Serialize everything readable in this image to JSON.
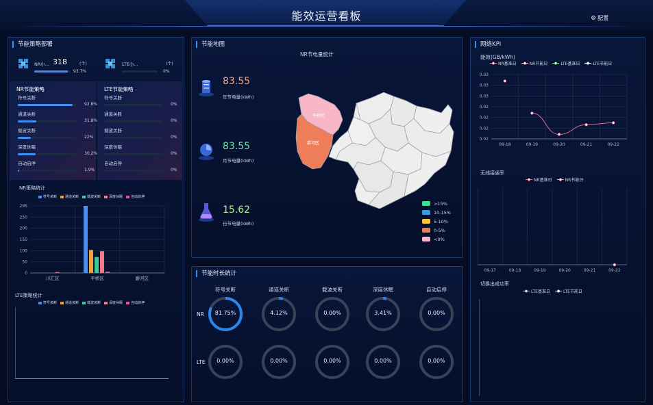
{
  "header": {
    "title": "能效运营看板",
    "config_label": "配置"
  },
  "left": {
    "title": "节能策略部署",
    "nr_summary": {
      "label": "NR小...",
      "count": "318",
      "unit": "(个)",
      "pct": "93.7%",
      "fill": 0.937
    },
    "lte_summary": {
      "label": "LTE小...",
      "unit": "(个)",
      "pct": "0%",
      "fill": 0
    },
    "nr_strategy": {
      "title": "NR节能策略",
      "items": [
        {
          "label": "符号关断",
          "pct": "92.8%",
          "fill": 0.928
        },
        {
          "label": "通道关断",
          "pct": "31.8%",
          "fill": 0.318
        },
        {
          "label": "载波关断",
          "pct": "22%",
          "fill": 0.22
        },
        {
          "label": "深度休眠",
          "pct": "30.2%",
          "fill": 0.302
        },
        {
          "label": "自动启停",
          "pct": "1.9%",
          "fill": 0.019
        }
      ]
    },
    "lte_strategy": {
      "title": "LTE节能策略",
      "items": [
        {
          "label": "符号关断",
          "pct": "0%"
        },
        {
          "label": "通道关断",
          "pct": "0%"
        },
        {
          "label": "载波关断",
          "pct": "0%"
        },
        {
          "label": "深度休眠",
          "pct": "0%"
        },
        {
          "label": "自动启停",
          "pct": "0%"
        }
      ]
    },
    "nr_chart_title": "NR策略统计",
    "lte_chart_title": "LTE策略统计"
  },
  "legend_strategy": [
    "符号关断",
    "通道关断",
    "载波关断",
    "深度休眠",
    "自动启停"
  ],
  "chart_data": [
    {
      "type": "bar",
      "title": "NR策略统计",
      "categories": [
        "川汇区",
        "平桥区",
        "爵河区"
      ],
      "ylim": [
        0,
        295
      ],
      "yticks": [
        "295",
        "250",
        "200",
        "150",
        "100",
        "50",
        "0"
      ],
      "series": [
        {
          "name": "符号关断",
          "color": "#4a8cf0",
          "values": [
            0,
            295,
            0
          ]
        },
        {
          "name": "通道关断",
          "color": "#f0a23a",
          "values": [
            0,
            101,
            0
          ]
        },
        {
          "name": "载波关断",
          "color": "#3cc99a",
          "values": [
            0,
            70,
            0
          ]
        },
        {
          "name": "深度休眠",
          "color": "#f07a8a",
          "values": [
            4,
            96,
            0
          ]
        },
        {
          "name": "自动启停",
          "color": "#e0508a",
          "values": [
            0,
            6,
            0
          ]
        }
      ]
    },
    {
      "type": "line",
      "title": "能效(GB/kWh)",
      "categories": [
        "09-18",
        "09-19",
        "09-20",
        "09-21",
        "09-22"
      ],
      "yticks": [
        "0.03",
        "0.03",
        "0.03",
        "0.02",
        "0.02",
        "0.02",
        "0.02"
      ],
      "legend": [
        "NR基准日",
        "NR节能日",
        "LTE基准日",
        "LTE节能日"
      ],
      "series": [
        {
          "name": "NR节能日",
          "color": "#e26a86",
          "values": [
            0.0285,
            0.0235,
            0.0202,
            0.0217,
            0.022
          ]
        }
      ]
    }
  ],
  "map": {
    "panel_title": "节能地图",
    "chart_title": "NR节电量统计",
    "stats": [
      {
        "value": "83.55",
        "label": "年节电量(kWh)",
        "color": "#f3a67a"
      },
      {
        "value": "83.55",
        "label": "月节电量(kWh)",
        "color": "#6fe0a8"
      },
      {
        "value": "15.62",
        "label": "日节电量(kWh)",
        "color": "#b3f08a"
      }
    ],
    "regions": {
      "a": "平桥区",
      "b": "爵河区"
    },
    "legend": [
      {
        "label": ">15%",
        "color": "#3ee08e"
      },
      {
        "label": "10-15%",
        "color": "#2e9ef0"
      },
      {
        "label": "5-10%",
        "color": "#f2c43a"
      },
      {
        "label": "0-5%",
        "color": "#ee7d5a"
      },
      {
        "label": "<0%",
        "color": "#f8b6c8"
      }
    ]
  },
  "duration": {
    "title": "节能时长统计",
    "columns": [
      "符号关断",
      "通道关断",
      "载波关断",
      "深度休眠",
      "自动启停"
    ],
    "rows": [
      {
        "label": "NR",
        "values": [
          "81.75%",
          "4.12%",
          "0.00%",
          "3.41%",
          "0.00%"
        ],
        "fills": [
          0.8175,
          0.0412,
          0,
          0.0341,
          0
        ]
      },
      {
        "label": "LTE",
        "values": [
          "0.00%",
          "0.00%",
          "0.00%",
          "0.00%",
          "0.00%"
        ],
        "fills": [
          0,
          0,
          0,
          0,
          0
        ]
      }
    ]
  },
  "kpi": {
    "title": "网络KPI",
    "xlabels2": [
      "09-17",
      "09-18",
      "09-19",
      "09-20",
      "09-21",
      "09-22"
    ],
    "access_title": "无线接通率",
    "access_legend": [
      "NR基准日",
      "NR节能日"
    ],
    "handover_title": "切换出成功率",
    "handover_legend": [
      "LTE基准日",
      "LTE节能日"
    ]
  }
}
